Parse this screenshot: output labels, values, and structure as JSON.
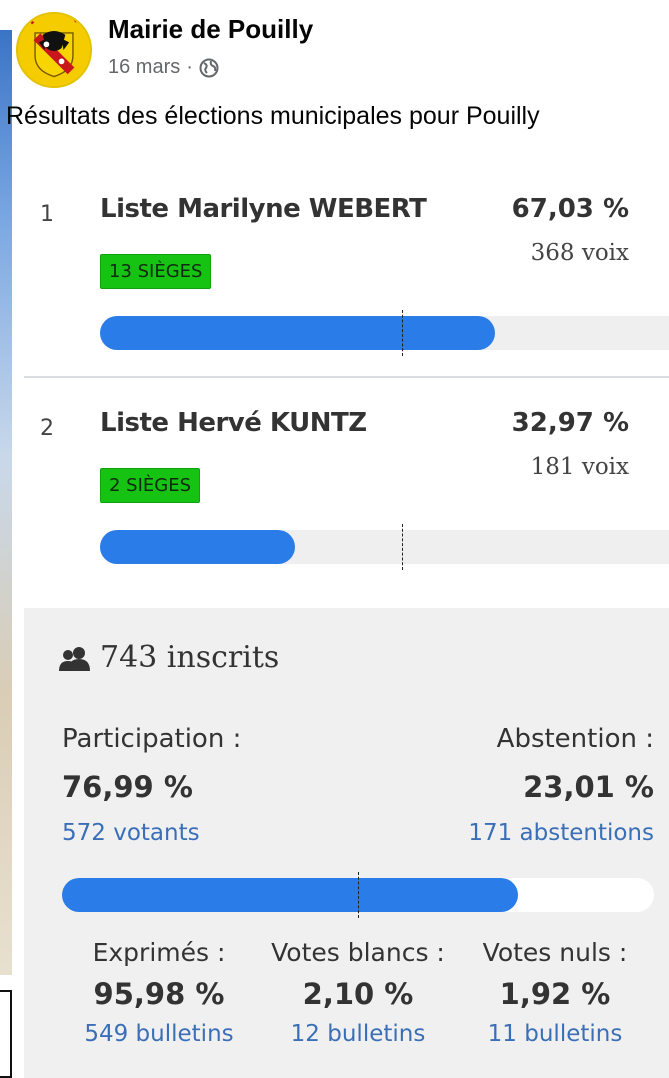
{
  "post": {
    "page_name": "Mairie de Pouilly",
    "date": "16 mars",
    "separator": "·",
    "text": "Résultats des élections municipales pour Pouilly"
  },
  "results": [
    {
      "rank": "1",
      "name": "Liste Marilyne WEBERT",
      "percent": "67,03 %",
      "votes": "368 voix",
      "seats": "13 SIÈGES",
      "share": 0.6703
    },
    {
      "rank": "2",
      "name": "Liste Hervé KUNTZ",
      "percent": "32,97 %",
      "votes": "181 voix",
      "seats": "2 SIÈGES",
      "share": 0.3297
    }
  ],
  "stats": {
    "inscrits": "743 inscrits",
    "participation_label": "Participation :",
    "participation_pct": "76,99 %",
    "participation_sub": "572 votants",
    "participation_share": 0.7699,
    "abstention_label": "Abstention :",
    "abstention_pct": "23,01 %",
    "abstention_sub": "171 abstentions",
    "exprimes_label": "Exprimés :",
    "exprimes_pct": "95,98 %",
    "exprimes_sub": "549 bulletins",
    "blancs_label": "Votes blancs :",
    "blancs_pct": "2,10 %",
    "blancs_sub": "12 bulletins",
    "nuls_label": "Votes nuls :",
    "nuls_pct": "1,92 %",
    "nuls_sub": "11 bulletins"
  },
  "icons": {
    "globe": "globe-icon",
    "users": "users-icon",
    "chevron": "chevron-right-icon"
  },
  "colors": {
    "bar": "#2a7de8",
    "seat_badge": "#16c313",
    "link_blue": "#3a6fb8"
  }
}
